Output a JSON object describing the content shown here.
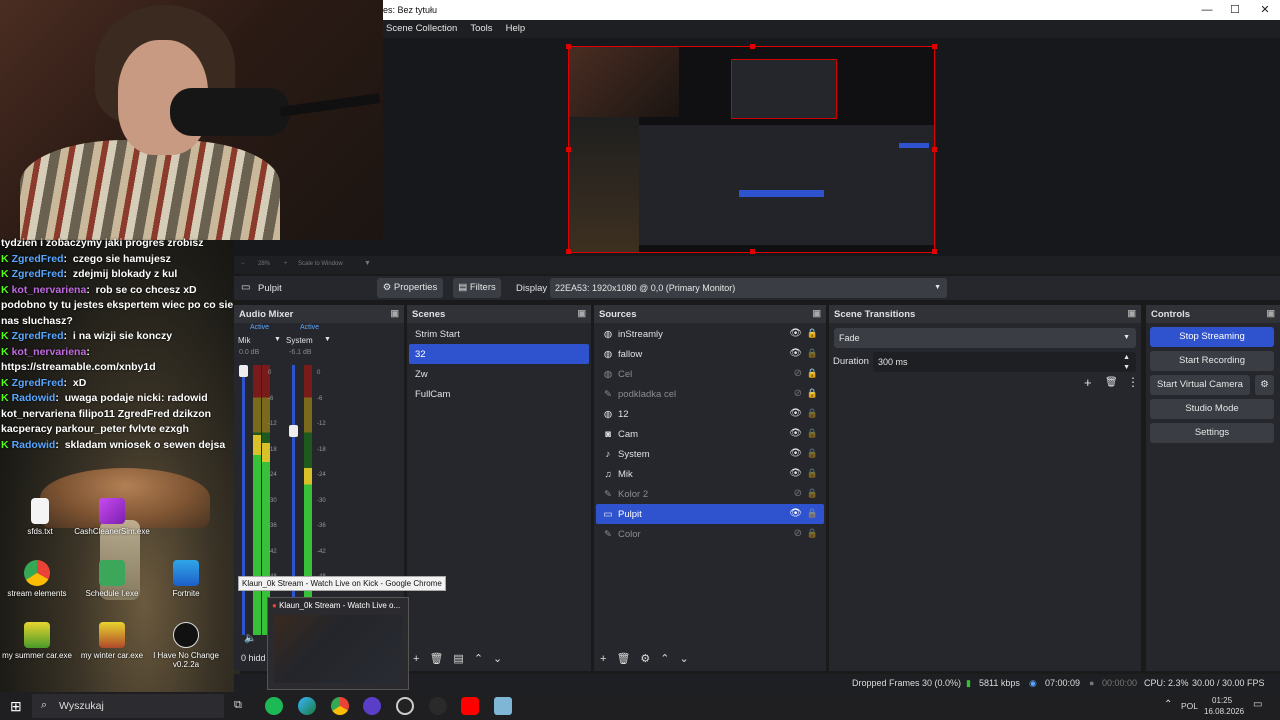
{
  "obs": {
    "window_title": "es: Bez tytułu",
    "menu": [
      "Scene Collection",
      "Tools",
      "Help"
    ],
    "zoom": {
      "level": "28%",
      "scale_label": "Scale to Window"
    },
    "source_label": "Pulpit",
    "properties_label": "Properties",
    "filters_label": "Filters",
    "display_label": "Display",
    "display_value": "22EA53: 1920x1080 @ 0,0 (Primary Monitor)",
    "audio_mixer": {
      "title": "Audio Mixer",
      "channels": [
        {
          "name": "Mik",
          "status": "Active",
          "db": "0.0 dB",
          "level": 0.74
        },
        {
          "name": "System",
          "status": "Active",
          "db": "-6.1 dB",
          "level": 0.62
        }
      ],
      "ticks": [
        "0",
        "-6",
        "-12",
        "-18",
        "-24",
        "-30",
        "-36",
        "-42",
        "-48"
      ],
      "hidden_label": "0 hidd"
    },
    "scenes": {
      "title": "Scenes",
      "items": [
        "Strim Start",
        "32",
        "Zw",
        "FullCam"
      ],
      "selected": 1
    },
    "sources": {
      "title": "Sources",
      "items": [
        {
          "name": "inStreamly",
          "icon": "globe-icon",
          "visible": true,
          "locked": true
        },
        {
          "name": "fallow",
          "icon": "globe-icon",
          "visible": true,
          "locked": false
        },
        {
          "name": "Cel",
          "icon": "globe-icon",
          "visible": false,
          "locked": true
        },
        {
          "name": "podkladka cel",
          "icon": "brush-icon",
          "visible": false,
          "locked": true
        },
        {
          "name": "12",
          "icon": "globe-icon",
          "visible": true,
          "locked": false
        },
        {
          "name": "Cam",
          "icon": "camera-icon",
          "visible": true,
          "locked": false
        },
        {
          "name": "System",
          "icon": "speaker-icon",
          "visible": true,
          "locked": false
        },
        {
          "name": "Mik",
          "icon": "mic-icon",
          "visible": true,
          "locked": false
        },
        {
          "name": "Kolor 2",
          "icon": "brush-icon",
          "visible": false,
          "locked": false
        },
        {
          "name": "Pulpit",
          "icon": "monitor-icon",
          "visible": true,
          "locked": false
        },
        {
          "name": "Color",
          "icon": "brush-icon",
          "visible": false,
          "locked": false
        }
      ],
      "selected": 9
    },
    "transitions": {
      "title": "Scene Transitions",
      "value": "Fade",
      "duration_label": "Duration",
      "duration_value": "300 ms"
    },
    "controls": {
      "title": "Controls",
      "buttons": [
        "Stop Streaming",
        "Start Recording",
        "Start Virtual Camera",
        "Studio Mode",
        "Settings"
      ],
      "accent": "#2f53cf"
    },
    "status": {
      "dropped": "Dropped Frames 30 (0.0%)",
      "bitrate": "5811 kbps",
      "stream_time": "07:00:09",
      "rec_time": "00:00:00",
      "cpu": "CPU: 2.3%",
      "fps": "30.00 / 30.00 FPS"
    }
  },
  "chat": [
    {
      "user": "",
      "msg": "tydzien i zobaczymy jaki progres zrobisz",
      "cont": true
    },
    {
      "user": "ZgredFred",
      "msg": "czego sie hamujesz"
    },
    {
      "user": "ZgredFred",
      "msg": "zdejmij blokady z kul"
    },
    {
      "user": "kot_nervariena",
      "msg": "rob se co chcesz xD podobno ty tu jestes ekspertem wiec po co sie nas sluchasz?"
    },
    {
      "user": "ZgredFred",
      "msg": "i na wizji sie konczy"
    },
    {
      "user": "kot_nervariena",
      "msg": "https://streamable.com/xnby1d"
    },
    {
      "user": "ZgredFred",
      "msg": "xD"
    },
    {
      "user": "Radowid",
      "msg": "uwaga podaje nicki: radowid kot_nervariena filipo11 ZgredFred dzikzon kacperacy parkour_peter fvlvte ezxgh"
    },
    {
      "user": "Radowid",
      "msg": "skladam wniosek o sewen dejsa"
    }
  ],
  "desktop_icons": [
    "sfds.txt",
    "CashCleanerSim.exe",
    "stream elements",
    "Schedule I.exe",
    "Fortnite",
    "my summer car.exe",
    "my winter car.exe",
    "I Have No Change v0.2.2a"
  ],
  "tooltip": "Klaun_0k Stream - Watch Live on Kick - Google Chrome",
  "thumb_title": "Klaun_0k Stream - Watch Live o...",
  "taskbar": {
    "search_placeholder": "Wyszukaj",
    "lang": "POL",
    "time": "01:25",
    "date": "16.08.2026"
  }
}
